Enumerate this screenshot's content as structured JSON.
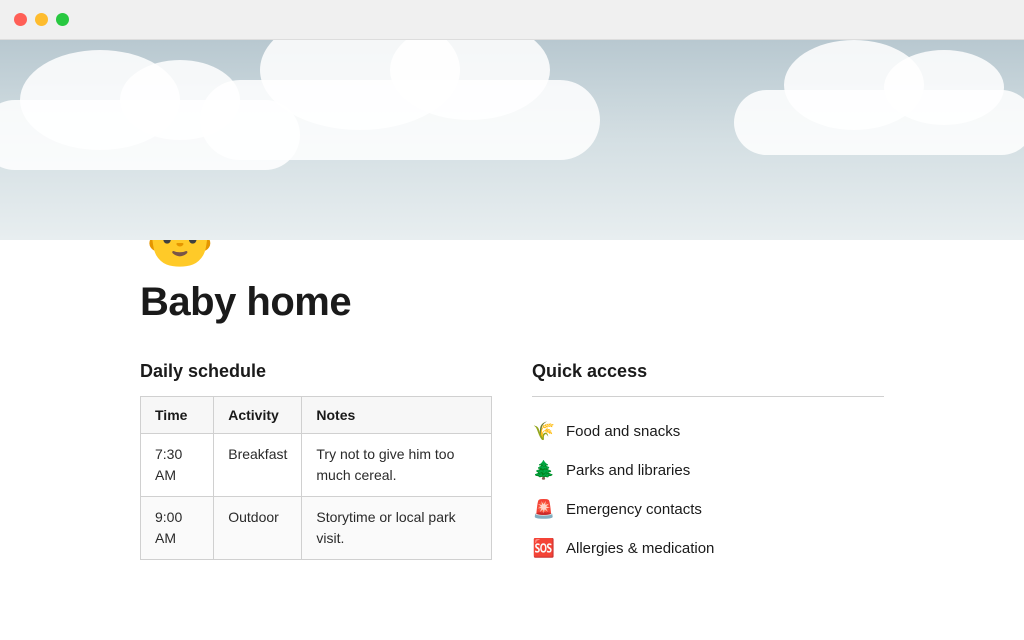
{
  "titlebar": {
    "dots": [
      "red",
      "yellow",
      "green"
    ]
  },
  "page": {
    "icon": "👶",
    "title": "Baby home"
  },
  "daily_schedule": {
    "section_title": "Daily schedule",
    "columns": [
      "Time",
      "Activity",
      "Notes"
    ],
    "rows": [
      {
        "time": "7:30 AM",
        "activity": "Breakfast",
        "notes": "Try not to give him too much cereal."
      },
      {
        "time": "9:00 AM",
        "activity": "Outdoor",
        "notes": "Storytime or local park visit."
      }
    ]
  },
  "quick_access": {
    "section_title": "Quick access",
    "items": [
      {
        "emoji": "🌾",
        "label": "Food and snacks"
      },
      {
        "emoji": "🌲",
        "label": "Parks and libraries"
      },
      {
        "emoji": "🚨",
        "label": "Emergency contacts"
      },
      {
        "emoji": "🆘",
        "label": "Allergies & medication"
      }
    ]
  }
}
